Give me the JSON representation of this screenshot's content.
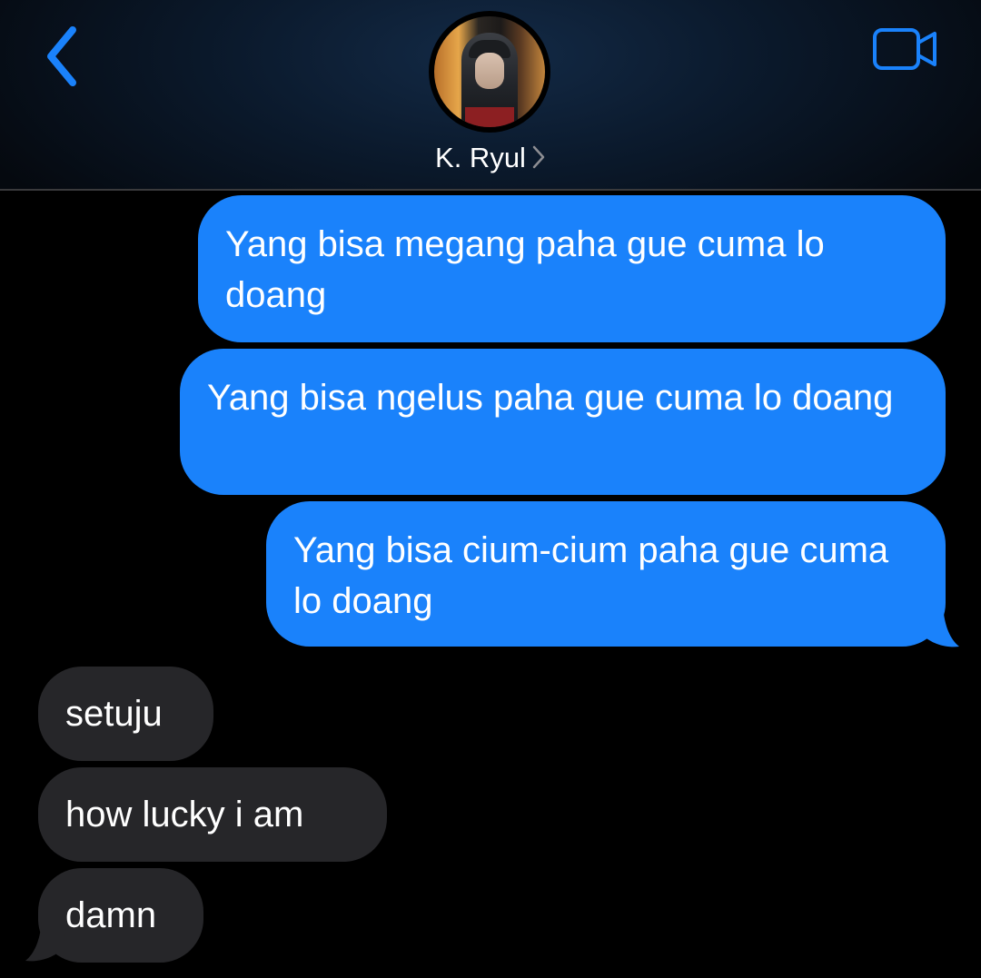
{
  "header": {
    "contact_name": "K. Ryul",
    "accent_color": "#1A82FB",
    "icons": {
      "back": "chevron-left-icon",
      "video": "video-camera-icon",
      "name_chevron": "chevron-right-icon"
    }
  },
  "messages": [
    {
      "direction": "sent",
      "text": "Yang bisa megang paha gue cuma lo doang"
    },
    {
      "direction": "sent",
      "text": "Yang bisa ngelus paha gue cuma lo doang"
    },
    {
      "direction": "sent",
      "text": "Yang bisa cium-cium paha gue cuma lo doang"
    },
    {
      "direction": "received",
      "text": "setuju"
    },
    {
      "direction": "received",
      "text": "how lucky i am"
    },
    {
      "direction": "received",
      "text": "damn"
    }
  ],
  "colors": {
    "sent_bubble": "#1A82FB",
    "received_bubble": "#262629",
    "background": "#000000"
  }
}
